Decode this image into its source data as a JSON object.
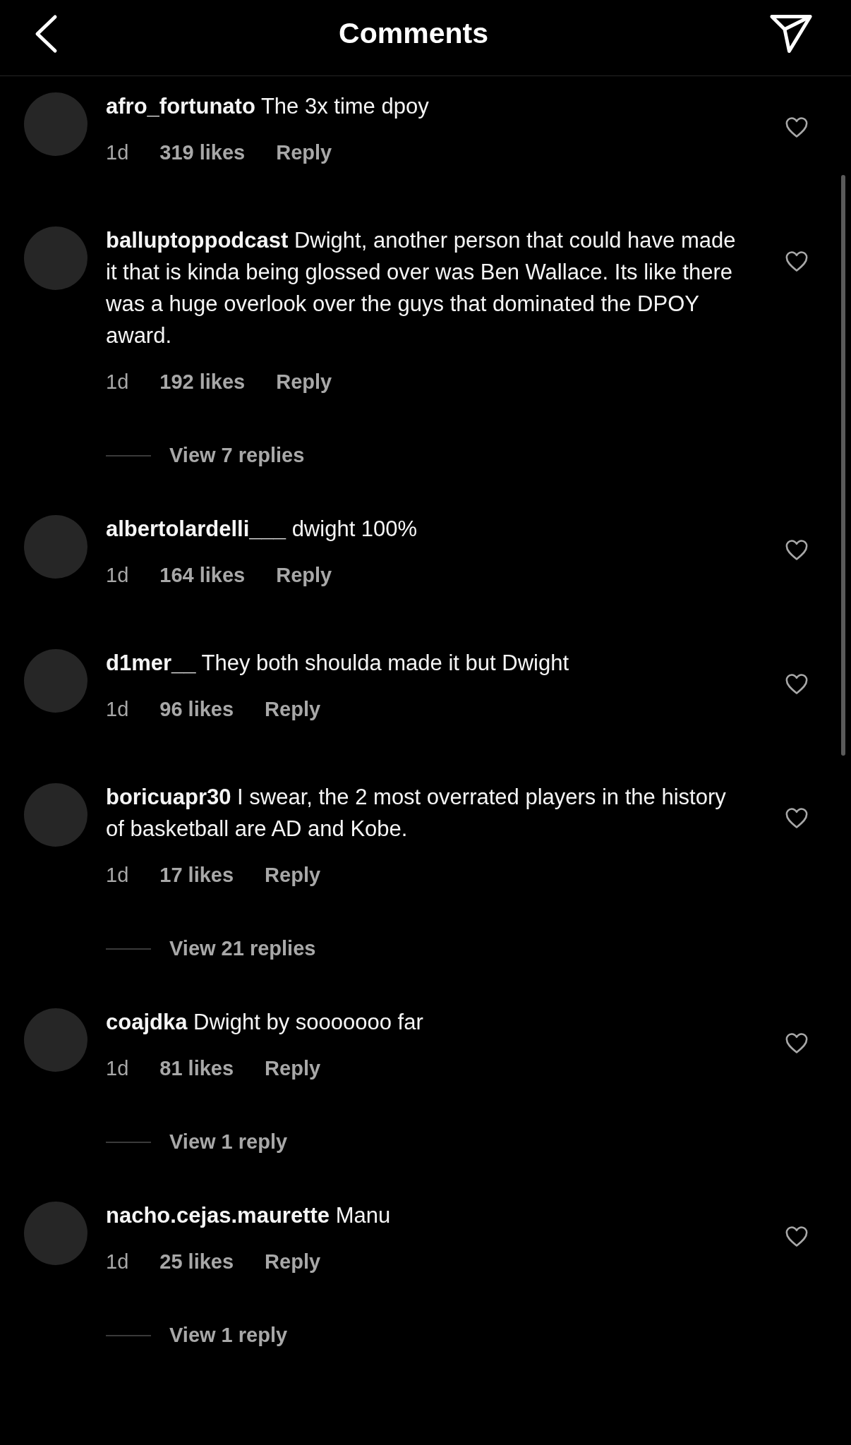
{
  "header": {
    "title": "Comments"
  },
  "comments": [
    {
      "text": "**afro_fortunato** The 3x time dpoy",
      "time": "1d",
      "likes": "319 likes",
      "reply": "Reply"
    },
    {
      "text": "**balluptoppodcast** Dwight, another person that could have made it that is kinda being glossed over was Ben Wallace. Its like there was a huge overlook over the guys that dominated the DPOY award.",
      "time": "1d",
      "likes": "192 likes",
      "reply": "Reply",
      "view_replies": "View 7 replies"
    },
    {
      "text": "**albertolardelli___** dwight 100%",
      "time": "1d",
      "likes": "164 likes",
      "reply": "Reply"
    },
    {
      "text": "**d1mer__** They both shoulda made it but Dwight",
      "time": "1d",
      "likes": "96 likes",
      "reply": "Reply"
    },
    {
      "text": "**boricuapr30** I swear, the 2 most overrated players in the history of basketball are AD and Kobe.",
      "time": "1d",
      "likes": "17 likes",
      "reply": "Reply",
      "view_replies": "View 21 replies"
    },
    {
      "text": "**coajdka** Dwight by sooooooo far",
      "time": "1d",
      "likes": "81 likes",
      "reply": "Reply",
      "view_replies": "View 1 reply"
    },
    {
      "text": "**nacho.cejas.maurette** Manu",
      "time": "1d",
      "likes": "25 likes",
      "reply": "Reply",
      "view_replies": "View 1 reply"
    }
  ]
}
